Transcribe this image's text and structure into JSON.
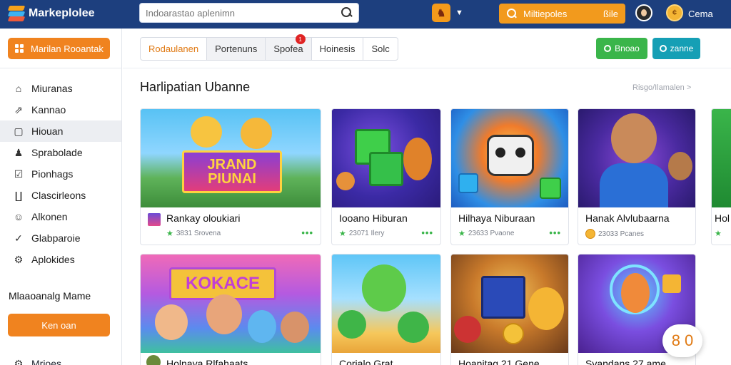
{
  "app": {
    "logo_text": "Markeplolee",
    "search_placeholder": "Indoarastao aplenimn",
    "gamepad_label": "♞",
    "market_button": {
      "label": "Miltiepoles",
      "right": "ßile"
    },
    "user_name": "Cema",
    "coin_label": "¢"
  },
  "sidebar": {
    "top_button": "Marilan Rooantak",
    "items": [
      {
        "icon": "home-icon",
        "glyph": "⌂",
        "label": "Miuranas"
      },
      {
        "icon": "trend-icon",
        "glyph": "⇗",
        "label": "Kannao"
      },
      {
        "icon": "square-icon",
        "glyph": "▢",
        "label": "Hiouan",
        "active": true
      },
      {
        "icon": "person-icon",
        "glyph": "♟",
        "label": "Sprabolade"
      },
      {
        "icon": "checklist-icon",
        "glyph": "☑",
        "label": "Pionhags"
      },
      {
        "icon": "cart-icon",
        "glyph": "∐",
        "label": "Clascirleons"
      },
      {
        "icon": "user-icon",
        "glyph": "☺",
        "label": "Alkonen"
      },
      {
        "icon": "check-icon",
        "glyph": "✓",
        "label": "Glabparoie"
      },
      {
        "icon": "gear-icon",
        "glyph": "⚙",
        "label": "Aplokides"
      }
    ],
    "heading": "Mlaaoanalg Mame",
    "bottom_button": "Ken oan",
    "bottom_item": "Mrioes"
  },
  "toolbar": {
    "tabs": [
      {
        "label": "Rodaulanen",
        "active": true
      },
      {
        "label": "Portenuns",
        "grey": true
      },
      {
        "label": "Spofea",
        "badge": "1",
        "grey": true
      },
      {
        "label": "Hoinesis"
      },
      {
        "label": "Solc"
      }
    ],
    "green_button": "Bnoao",
    "teal_button": "zanne"
  },
  "section": {
    "title": "Harlipatian Ubanne",
    "view_all": "Risgo/Ilamalen"
  },
  "cards": [
    {
      "title": "Rankay oloukiari",
      "meta": "3831 Srovena",
      "meta_icon": "box",
      "thumb_text": "JRAND PIUNAI"
    },
    {
      "title": "Iooano Hiburan",
      "meta": "23071 Ilery",
      "meta_icon": "star"
    },
    {
      "title": "Hilhaya Niburaan",
      "meta": "23633 Pvaone",
      "meta_icon": "star"
    },
    {
      "title": "Hanak Alvlubaarna",
      "meta": "23033 Pcanes",
      "meta_icon": "coin"
    },
    {
      "title": "Hol",
      "meta": "",
      "meta_icon": "star"
    },
    {
      "title": "Holnaya Rlfahaats",
      "meta": "",
      "meta_icon": "",
      "thumb_text": "KOKACE"
    },
    {
      "title": "Corjalo Grat",
      "meta": "",
      "meta_icon": ""
    },
    {
      "title": "Hoanitag 21 Gene",
      "meta": "",
      "meta_icon": ""
    },
    {
      "title": "Svandans 27 ame",
      "meta": "",
      "meta_icon": ""
    }
  ],
  "float_badge": "8 0"
}
